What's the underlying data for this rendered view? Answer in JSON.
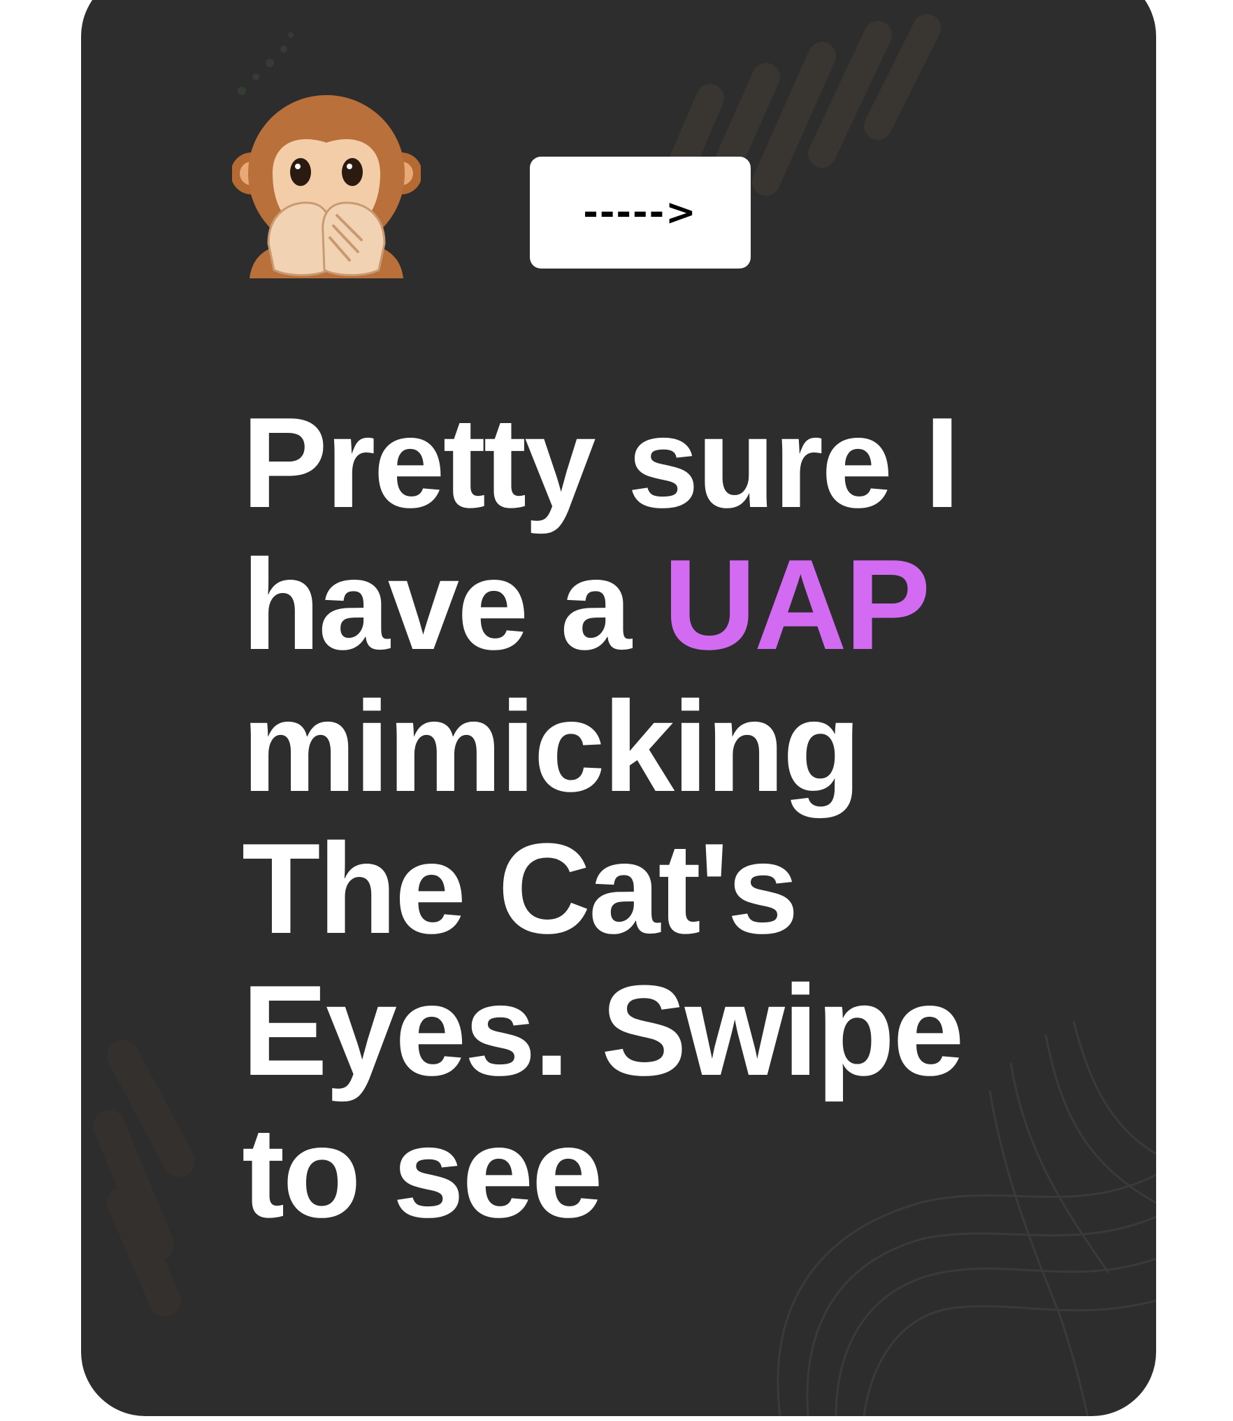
{
  "card": {
    "background": "#2d2d2d"
  },
  "emoji": {
    "icon": "speak-no-evil-monkey-icon"
  },
  "swipe_button": {
    "label": "----->"
  },
  "headline": {
    "line1": "Pretty sure I",
    "line2_before": "have a ",
    "line2_accent": "UAP",
    "line3": "mimicking",
    "line4": "The Cat's",
    "line5": "Eyes. Swipe",
    "line6": "to see",
    "accent_color": "#d26bf2",
    "text_color": "#ffffff"
  }
}
